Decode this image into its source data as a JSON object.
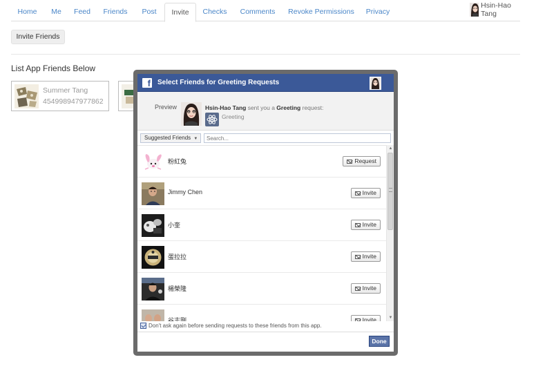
{
  "nav": {
    "tabs": [
      {
        "label": "Home"
      },
      {
        "label": "Me"
      },
      {
        "label": "Feed"
      },
      {
        "label": "Friends"
      },
      {
        "label": "Post"
      },
      {
        "label": "Invite",
        "active": true
      },
      {
        "label": "Checks"
      },
      {
        "label": "Comments"
      },
      {
        "label": "Revoke Permissions"
      },
      {
        "label": "Privacy"
      }
    ],
    "user_name": "Hsin-Hao Tang"
  },
  "invite_friends_label": "Invite Friends",
  "list_title": "List App Friends Below",
  "app_friends": [
    {
      "name": "Summer Tang",
      "id": "454998947977862"
    },
    {
      "name": "",
      "id": ""
    }
  ],
  "dialog": {
    "title": "Select Friends for Greeting Requests",
    "preview_label": "Preview",
    "sender": "Hsin-Hao Tang",
    "message_mid": " sent you a ",
    "request_type": "Greeting",
    "message_end": " request:",
    "app_name": "Greeting",
    "filter_label": "Suggested Friends",
    "search_placeholder": "Search...",
    "friends": [
      {
        "name": "粉紅兔",
        "action": "Request"
      },
      {
        "name": "Jimmy Chen",
        "action": "Invite"
      },
      {
        "name": "小奎",
        "action": "Invite"
      },
      {
        "name": "蛋拉拉",
        "action": "Invite"
      },
      {
        "name": "楊榮隆",
        "action": "Invite"
      },
      {
        "name": "谷志剛",
        "action": "Invite"
      }
    ],
    "dont_ask_label": "Don't ask again before sending requests to these friends from this app.",
    "dont_ask_checked": true,
    "done_label": "Done"
  },
  "colors": {
    "fb_blue": "#3b5998",
    "link_blue": "#4a86c8",
    "dialog_frame": "#6b6b6b"
  }
}
